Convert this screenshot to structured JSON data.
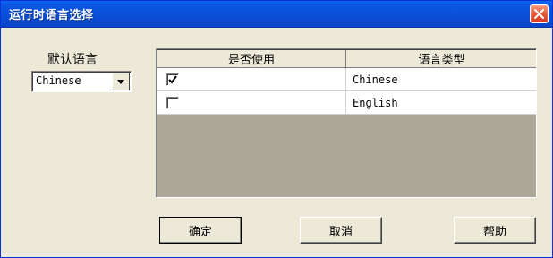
{
  "window": {
    "title": "运行时语言选择",
    "close_icon": "close-icon"
  },
  "left_panel": {
    "label": "默认语言",
    "selected_language": "Chinese"
  },
  "table": {
    "columns": [
      "是否使用",
      "语言类型"
    ],
    "rows": [
      {
        "enabled": true,
        "language": "Chinese"
      },
      {
        "enabled": false,
        "language": "English"
      }
    ]
  },
  "buttons": {
    "ok": "确定",
    "cancel": "取消",
    "help": "帮助"
  },
  "colors": {
    "titlebar": "#0a4fd8",
    "dialog_background": "#ece9d8",
    "table_empty_area": "#aca899"
  }
}
